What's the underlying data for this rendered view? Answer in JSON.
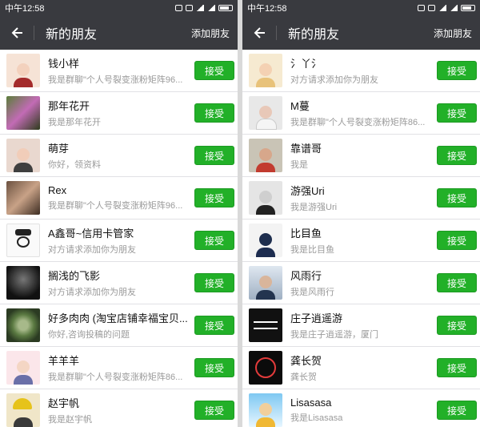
{
  "left": {
    "status": {
      "time": "中午12:58"
    },
    "header": {
      "back_icon": "arrow-left-icon",
      "title": "新的朋友",
      "action": "添加朋友"
    },
    "rows": [
      {
        "name": "钱小样",
        "sub": "我是群聊\"个人号裂变涨粉矩阵96...",
        "button": "接受"
      },
      {
        "name": "那年花开",
        "sub": "我是那年花开",
        "button": "接受"
      },
      {
        "name": "萌芽",
        "sub": "你好，领资料",
        "button": "接受"
      },
      {
        "name": "Rex",
        "sub": "我是群聊\"个人号裂变涨粉矩阵96...",
        "button": "接受"
      },
      {
        "name": "A鑫哥~信用卡管家",
        "sub": "对方请求添加你为朋友",
        "button": "接受"
      },
      {
        "name": "搁浅的飞影",
        "sub": "对方请求添加你为朋友",
        "button": "接受"
      },
      {
        "name": "好多肉肉 (淘宝店铺幸福宝贝...",
        "sub": "你好,咨询投稿的问题",
        "button": "接受"
      },
      {
        "name": "羊羊羊",
        "sub": "我是群聊\"个人号裂变涨粉矩阵86...",
        "button": "接受"
      },
      {
        "name": "赵宇帆",
        "sub": "我是赵宇帆",
        "button": "接受"
      }
    ]
  },
  "right": {
    "status": {
      "time": "中午12:58"
    },
    "header": {
      "back_icon": "arrow-left-icon",
      "title": "新的朋友",
      "action": "添加朋友"
    },
    "rows": [
      {
        "name": "氵丫氵",
        "sub": "对方请求添加你为朋友",
        "button": "接受"
      },
      {
        "name": "M蔓",
        "sub": "我是群聊\"个人号裂变涨粉矩阵86...",
        "button": "接受"
      },
      {
        "name": "靠谱哥",
        "sub": "我是",
        "button": "接受"
      },
      {
        "name": "游强Uri",
        "sub": "我是游强Uri",
        "button": "接受"
      },
      {
        "name": "比目鱼",
        "sub": "我是比目鱼",
        "button": "接受"
      },
      {
        "name": "风雨行",
        "sub": "我是风雨行",
        "button": "接受"
      },
      {
        "name": "庄子逍遥游",
        "sub": "我是庄子逍遥游，厦门",
        "button": "接受"
      },
      {
        "name": "龚长贺",
        "sub": "龚长贺",
        "button": "接受"
      },
      {
        "name": "Lisasasa",
        "sub": "我是Lisasasa",
        "button": "接受"
      }
    ]
  }
}
